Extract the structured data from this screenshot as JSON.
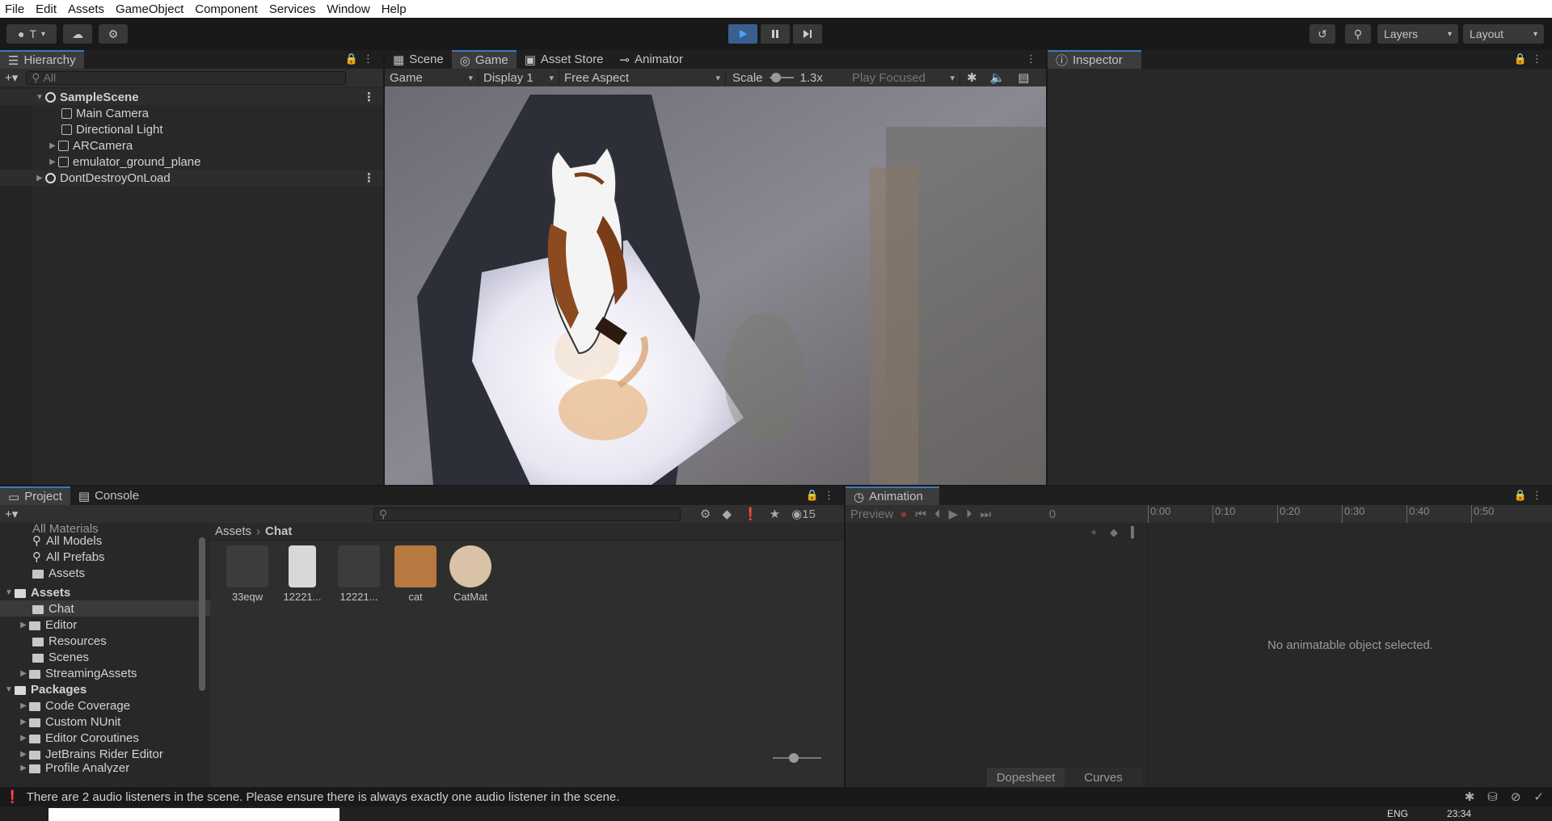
{
  "menu": [
    "File",
    "Edit",
    "Assets",
    "GameObject",
    "Component",
    "Services",
    "Window",
    "Help"
  ],
  "toolbar": {
    "account_label": "T",
    "layers_label": "Layers",
    "layout_label": "Layout"
  },
  "hierarchy": {
    "tab_label": "Hierarchy",
    "search_placeholder": "All",
    "scene": "SampleScene",
    "items": [
      "Main Camera",
      "Directional Light",
      "ARCamera",
      "emulator_ground_plane"
    ],
    "dont_destroy": "DontDestroyOnLoad"
  },
  "center_tabs": {
    "scene": "Scene",
    "game": "Game",
    "asset_store": "Asset Store",
    "animator": "Animator"
  },
  "game_toolbar": {
    "mode": "Game",
    "display": "Display 1",
    "aspect": "Free Aspect",
    "scale_label": "Scale",
    "scale_value": "1.3x",
    "play_focused": "Play Focused"
  },
  "inspector": {
    "tab_label": "Inspector"
  },
  "project": {
    "tab_label": "Project",
    "console_label": "Console",
    "hidden_count": "15",
    "favorites": [
      "All Materials",
      "All Models",
      "All Prefabs",
      "Assets"
    ],
    "assets_root": "Assets",
    "asset_folders": [
      "Chat",
      "Editor",
      "Resources",
      "Scenes",
      "StreamingAssets"
    ],
    "packages_root": "Packages",
    "package_folders": [
      "Code Coverage",
      "Custom NUnit",
      "Editor Coroutines",
      "JetBrains Rider Editor",
      "Profile Analyzer"
    ],
    "breadcrumb": [
      "Assets",
      "Chat"
    ],
    "files": [
      "33eqw",
      "12221...",
      "12221...",
      "cat",
      "CatMat"
    ]
  },
  "animation": {
    "tab_label": "Animation",
    "preview_label": "Preview",
    "frame_value": "0",
    "timeline_ticks": [
      "0:00",
      "0:10",
      "0:20",
      "0:30",
      "0:40",
      "0:50"
    ],
    "empty_message": "No animatable object selected.",
    "dopesheet_label": "Dopesheet",
    "curves_label": "Curves"
  },
  "status": {
    "message": "There are 2 audio listeners in the scene. Please ensure there is always exactly one audio listener in the scene."
  },
  "taskbar": {
    "lang": "ENG",
    "time": "23:34"
  },
  "colors": {
    "accent": "#3a79bb",
    "panel": "#282828",
    "bg": "#191919"
  }
}
